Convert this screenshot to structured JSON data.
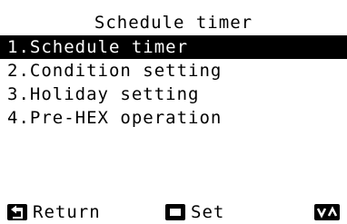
{
  "screen": {
    "title": "Schedule timer"
  },
  "menu": {
    "selected_index": 0,
    "items": [
      {
        "label": "1.Schedule timer"
      },
      {
        "label": "2.Condition setting"
      },
      {
        "label": "3.Holiday setting"
      },
      {
        "label": "4.Pre-HEX operation"
      }
    ]
  },
  "footer": {
    "return_label": "Return",
    "return_icon": "return-arrow-icon",
    "set_label": "Set",
    "set_icon": "set-square-icon",
    "nav_icon": "up-down-arrows-icon"
  },
  "colors": {
    "background": "#ffffff",
    "foreground": "#000000",
    "highlight_bg": "#000000",
    "highlight_fg": "#ffffff"
  }
}
